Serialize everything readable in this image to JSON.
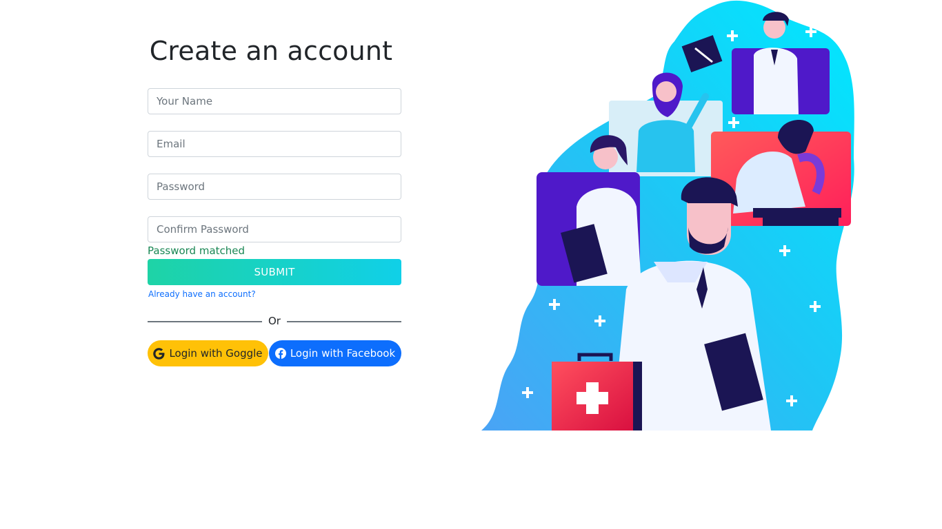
{
  "form": {
    "title": "Create an account",
    "name_placeholder": "Your Name",
    "email_placeholder": "Email",
    "password_placeholder": "Password",
    "confirm_placeholder": "Confirm Password",
    "match_message": "Password matched",
    "submit_label": "SUBMIT",
    "login_link": "Already have an account?",
    "divider_text": "Or",
    "google_label": "Login with Goggle",
    "facebook_label": "Login with Facebook"
  },
  "colors": {
    "submit_gradient_start": "#1ed3a6",
    "submit_gradient_end": "#10d0e8",
    "google_button": "#ffc107",
    "facebook_button": "#0d6efd",
    "match_text": "#198754",
    "link": "#0d6efd"
  },
  "illustration": {
    "subject": "medical-team-illustration"
  }
}
